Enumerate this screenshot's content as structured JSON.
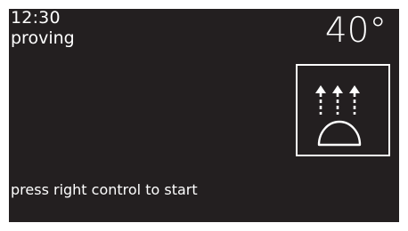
{
  "status": {
    "time": "12:30",
    "mode": "proving",
    "temperature": "40°"
  },
  "mode_icon": {
    "name": "proving-icon",
    "color": "#ffffff"
  },
  "prompt": {
    "text": "press right control to start"
  },
  "colors": {
    "screen_background": "#231f20",
    "text": "#ffffff",
    "frame": "#ffffff"
  }
}
